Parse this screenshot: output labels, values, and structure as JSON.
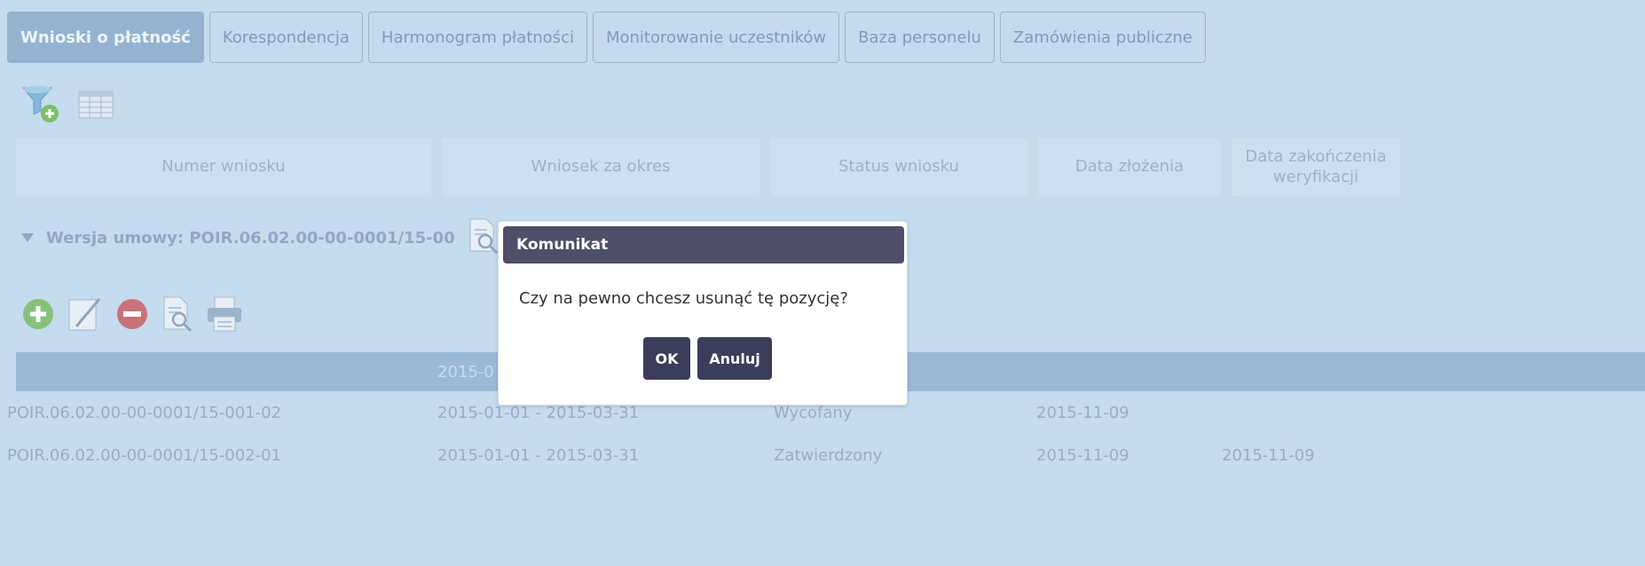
{
  "tabs": [
    {
      "label": "Wnioski o płatność"
    },
    {
      "label": "Korespondencja"
    },
    {
      "label": "Harmonogram płatności"
    },
    {
      "label": "Monitorowanie uczestników"
    },
    {
      "label": "Baza personelu"
    },
    {
      "label": "Zamówienia publiczne"
    }
  ],
  "toolbar": {
    "filter_icon": "filter-add-icon",
    "table_icon": "table-icon"
  },
  "table": {
    "columns": [
      {
        "label": "Numer wniosku"
      },
      {
        "label": "Wniosek za okres"
      },
      {
        "label": "Status wniosku"
      },
      {
        "label": "Data złożenia"
      },
      {
        "label": "Data zakończenia weryfikacji"
      }
    ],
    "version_label": "Wersja umowy: POIR.06.02.00-00-0001/15-00",
    "subheader_period": "2015-0",
    "rows": [
      {
        "number": "POIR.06.02.00-00-0001/15-001-02",
        "period": "2015-01-01 - 2015-03-31",
        "status": "Wycofany",
        "submitted": "2015-11-09",
        "verified": ""
      },
      {
        "number": "POIR.06.02.00-00-0001/15-002-01",
        "period": "2015-01-01 - 2015-03-31",
        "status": "Zatwierdzony",
        "submitted": "2015-11-09",
        "verified": "2015-11-09"
      }
    ]
  },
  "modal": {
    "title": "Komunikat",
    "message": "Czy na pewno chcesz usunąć tę pozycję?",
    "ok_label": "OK",
    "cancel_label": "Anuluj"
  },
  "colors": {
    "background": "#c5dbee",
    "modal_header": "#4f4f6a",
    "button": "#3c3d5a"
  }
}
